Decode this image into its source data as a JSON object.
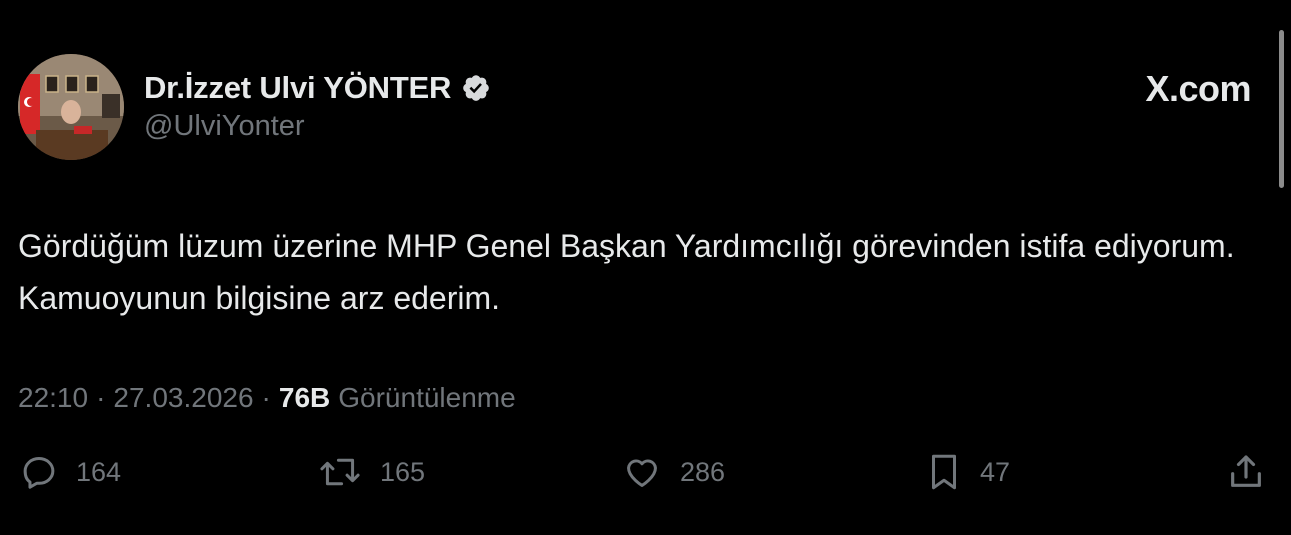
{
  "author": {
    "display_name": "Dr.İzzet Ulvi YÖNTER",
    "handle": "@UlviYonter",
    "verified_icon": "verified-badge-icon",
    "avatar_icon": "profile-avatar"
  },
  "brand": {
    "label": "X.com"
  },
  "tweet": {
    "text": "Gördüğüm lüzum üzerine MHP Genel Başkan Yardımcılığı görevinden istifa ediyorum. Kamuoyunun bilgisine arz ederim."
  },
  "meta": {
    "time": "22:10",
    "separator": "·",
    "date": "27.03.2026",
    "views_count": "76B",
    "views_label": "Görüntülenme"
  },
  "actions": {
    "replies": {
      "icon": "reply-icon",
      "count": "164"
    },
    "reposts": {
      "icon": "repost-icon",
      "count": "165"
    },
    "likes": {
      "icon": "like-icon",
      "count": "286"
    },
    "bookmarks": {
      "icon": "bookmark-icon",
      "count": "47"
    },
    "share": {
      "icon": "share-icon"
    }
  },
  "colors": {
    "background": "#000000",
    "primary_text": "#e7e9ea",
    "secondary_text": "#71767b"
  }
}
